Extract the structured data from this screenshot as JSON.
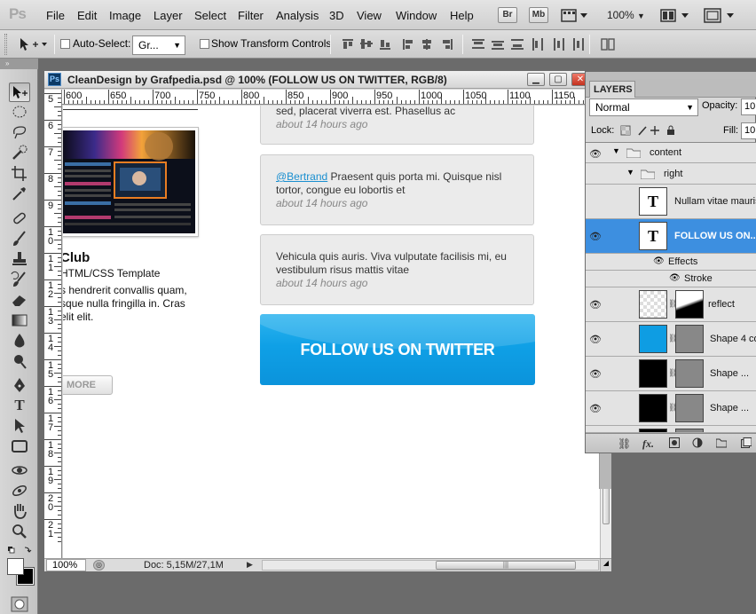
{
  "app": {
    "logo": "Ps"
  },
  "menu": [
    "File",
    "Edit",
    "Image",
    "Layer",
    "Select",
    "Filter",
    "Analysis",
    "3D",
    "View",
    "Window",
    "Help"
  ],
  "apptoolbar": {
    "bridge": "Br",
    "minibridge": "Mb",
    "zoom": "100%"
  },
  "options": {
    "auto_select_label": "Auto-Select:",
    "auto_select_value": "Gr...",
    "show_transform_label": "Show Transform Controls"
  },
  "document": {
    "title": "CleanDesign by Grafpedia.psd @ 100% (FOLLOW US ON TWITTER, RGB/8)",
    "ruler_h": [
      "600",
      "650",
      "700",
      "750",
      "800",
      "850",
      "900",
      "950",
      "1000",
      "1050",
      "1100",
      "1150"
    ],
    "ruler_v": [
      "5",
      "6",
      "7",
      "8",
      "9",
      "1 0",
      "1 1",
      "1 2",
      "1 3",
      "1 4",
      "1 5",
      "1 6",
      "1 7",
      "1 8",
      "1 9",
      "2 0",
      "2 1"
    ],
    "zoom": "100%",
    "doc_size": "Doc: 5,15M/27,1M"
  },
  "canvas": {
    "project_title": "Club",
    "project_sub": "HTML/CSS Template",
    "project_desc": "s hendrerit convallis quam, sque nulla fringilla in. Cras elit elit.",
    "more_label": "MORE",
    "tweets": [
      {
        "text": "sed, placerat viverra est. Phasellus ac",
        "time": "about 14 hours ago"
      },
      {
        "mention": "@Bertrand",
        "text": " Praesent quis porta mi. Quisque nisl tortor, congue eu lobortis et",
        "time": "about 14 hours ago"
      },
      {
        "text": "Vehicula quis auris. Viva vulputate facilisis mi, eu vestibulum risus mattis vitae",
        "time": "about 14 hours ago"
      }
    ],
    "follow_button": "FOLLOW US ON TWITTER"
  },
  "layers": {
    "tab": "LAYERS",
    "blend_mode": "Normal",
    "opacity_label": "Opacity:",
    "opacity_value": "10",
    "lock_label": "Lock:",
    "fill_label": "Fill:",
    "fill_value": "10",
    "rows": [
      {
        "name": "content",
        "kind": "group"
      },
      {
        "name": "right",
        "kind": "group"
      },
      {
        "name": "Nullam vitae mauris",
        "kind": "text"
      },
      {
        "name": "FOLLOW US ON...",
        "kind": "text",
        "selected": true
      },
      {
        "name": "Effects",
        "kind": "effects"
      },
      {
        "name": "Stroke",
        "kind": "effect"
      },
      {
        "name": "reflect",
        "kind": "mask"
      },
      {
        "name": "Shape 4 co",
        "kind": "shape-blue"
      },
      {
        "name": "Shape ...",
        "kind": "shape"
      },
      {
        "name": "Shape ...",
        "kind": "shape"
      }
    ],
    "text_thumb": "T"
  },
  "colors": {
    "accent_blue": "#0fa0e6",
    "selection": "#3d8fe0"
  }
}
